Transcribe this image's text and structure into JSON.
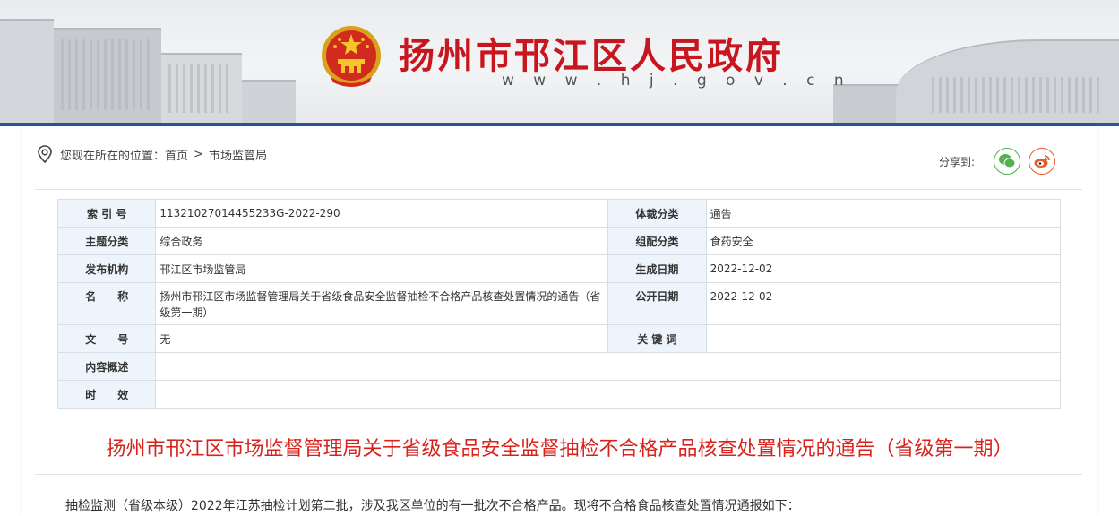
{
  "site": {
    "title": "扬州市邗江区人民政府",
    "url": "w w w . h j . g o v . c n"
  },
  "breadcrumb": {
    "prefix": "您现在所在的位置：",
    "home": "首页",
    "separator": ">",
    "current": "市场监管局"
  },
  "share": {
    "label": "分享到:"
  },
  "meta": {
    "rows": [
      {
        "k1": "索 引 号",
        "v1": "11321027014455233G-2022-290",
        "k2": "体裁分类",
        "v2": "通告"
      },
      {
        "k1": "主题分类",
        "v1": "综合政务",
        "k2": "组配分类",
        "v2": "食药安全"
      },
      {
        "k1": "发布机构",
        "v1": "邗江区市场监管局",
        "k2": "生成日期",
        "v2": "2022-12-02"
      },
      {
        "k1": "名　　称",
        "v1": "扬州市邗江区市场监督管理局关于省级食品安全监督抽检不合格产品核查处置情况的通告（省级第一期）",
        "k2": "公开日期",
        "v2": "2022-12-02"
      },
      {
        "k1": "文　　号",
        "v1": "无",
        "k2": "关 键 词",
        "v2": ""
      },
      {
        "k1": "内容概述",
        "v1": ""
      },
      {
        "k1": "时　　效",
        "v1": ""
      }
    ]
  },
  "article": {
    "title": "扬州市邗江区市场监督管理局关于省级食品安全监督抽检不合格产品核查处置情况的通告（省级第一期）",
    "intro": "抽检监测（省级本级）2022年江苏抽检计划第二批，涉及我区单位的有一批次不合格产品。现将不合格食品核查处置情况通报如下："
  },
  "colors": {
    "brand_red": "#c8161e",
    "title_red": "#d8231c",
    "header_bar": "#2a5596",
    "table_key_bg": "#eef4fb",
    "wechat_green": "#51b24c",
    "weibo_orange": "#e95a2b"
  },
  "icons": [
    "national-emblem-icon",
    "location-pin-icon",
    "wechat-icon",
    "weibo-icon"
  ]
}
